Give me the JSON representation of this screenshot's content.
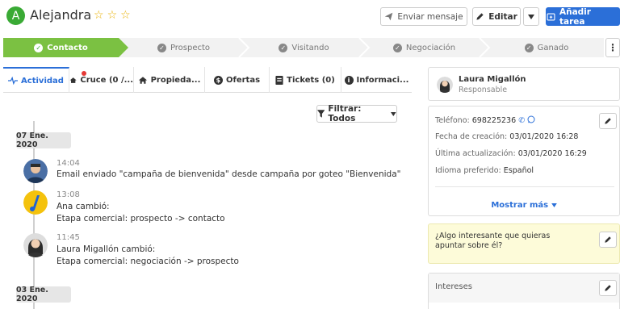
{
  "header": {
    "avatar_letter": "A",
    "name": "Alejandra",
    "rating_stars": 3,
    "send_message_label": "Enviar mensaje",
    "edit_label": "Editar",
    "add_task_label": "Añadir tarea",
    "accent_color": "#2b6fd8",
    "brand_green": "#3aaa35"
  },
  "pipeline": {
    "stages": [
      {
        "label": "Contacto",
        "active": true
      },
      {
        "label": "Prospecto",
        "active": false
      },
      {
        "label": "Visitando",
        "active": false
      },
      {
        "label": "Negociación",
        "active": false
      },
      {
        "label": "Ganado",
        "active": false
      }
    ]
  },
  "tabs": [
    {
      "label": "Actividad",
      "icon": "activity-icon",
      "active": true
    },
    {
      "label": "Cruce (0 /...",
      "icon": "house-icon",
      "active": false
    },
    {
      "label": "Propieda...",
      "icon": "home-icon",
      "active": false
    },
    {
      "label": "Ofertas",
      "icon": "dollar-icon",
      "active": false
    },
    {
      "label": "Tickets (0)",
      "icon": "ticket-icon",
      "active": false
    },
    {
      "label": "Informaci...",
      "icon": "info-icon",
      "active": false
    }
  ],
  "filter": {
    "label": "Filtrar: Todos"
  },
  "timeline": {
    "dates": [
      "07 Ene. 2020",
      "03 Ene. 2020"
    ],
    "events": [
      {
        "time": "14:04",
        "lines": [
          "Email enviado \"campaña de bienvenida\" desde campaña por goteo \"Bienvenida\""
        ],
        "avatar": "man-avatar"
      },
      {
        "time": "13:08",
        "lines": [
          "Ana cambió:",
          "Etapa comercial: prospecto -> contacto"
        ],
        "avatar": "logo-avatar"
      },
      {
        "time": "11:45",
        "lines": [
          "Laura Migallón cambió:",
          "Etapa comercial: negociación -> prospecto"
        ],
        "avatar": "woman-avatar"
      }
    ]
  },
  "owner": {
    "name": "Laura Migallón",
    "role": "Responsable"
  },
  "details": {
    "phone_label": "Teléfono:",
    "phone_value": "698225236",
    "created_label": "Fecha de creación:",
    "created_value": "03/01/2020 16:28",
    "updated_label": "Última actualización:",
    "updated_value": "03/01/2020 16:29",
    "language_label": "Idioma preferido:",
    "language_value": "Español",
    "show_more_label": "Mostrar más"
  },
  "note": {
    "text": "¿Algo interesante que quieras apuntar sobre él?"
  },
  "interests": {
    "title": "Intereses"
  }
}
